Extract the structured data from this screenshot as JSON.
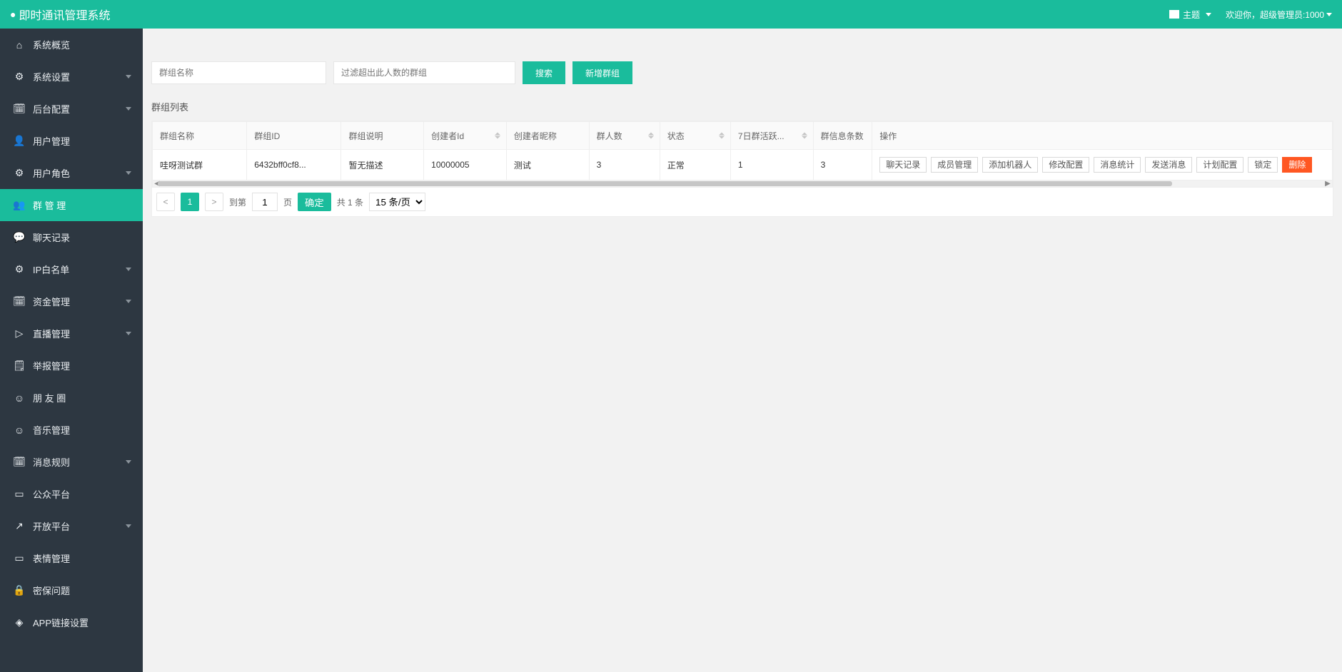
{
  "colors": {
    "accent": "#1abc9c",
    "sidebar": "#2d3741",
    "danger": "#ff5722"
  },
  "header": {
    "title": "即时通讯管理系统",
    "theme_label": "主题",
    "welcome": "欢迎你，超级管理员:1000"
  },
  "sidebar": {
    "items": [
      {
        "icon": "⌂",
        "label": "系统概览",
        "expandable": false
      },
      {
        "icon": "⚙",
        "label": "系统设置",
        "expandable": true
      },
      {
        "icon": "🗓",
        "label": "后台配置",
        "expandable": true
      },
      {
        "icon": "👤",
        "label": "用户管理",
        "expandable": false
      },
      {
        "icon": "⚙",
        "label": "用户角色",
        "expandable": true
      },
      {
        "icon": "👥",
        "label": "群 管 理",
        "expandable": false,
        "active": true
      },
      {
        "icon": "💬",
        "label": "聊天记录",
        "expandable": false
      },
      {
        "icon": "⚙",
        "label": "IP白名单",
        "expandable": true
      },
      {
        "icon": "🗓",
        "label": "资金管理",
        "expandable": true
      },
      {
        "icon": "▷",
        "label": "直播管理",
        "expandable": true
      },
      {
        "icon": "🗒",
        "label": "举报管理",
        "expandable": false
      },
      {
        "icon": "☺",
        "label": "朋 友 圈",
        "expandable": false
      },
      {
        "icon": "☺",
        "label": "音乐管理",
        "expandable": false
      },
      {
        "icon": "🗓",
        "label": "消息规则",
        "expandable": true
      },
      {
        "icon": "▭",
        "label": "公众平台",
        "expandable": false
      },
      {
        "icon": "↗",
        "label": "开放平台",
        "expandable": true
      },
      {
        "icon": "▭",
        "label": "表情管理",
        "expandable": false
      },
      {
        "icon": "🔒",
        "label": "密保问题",
        "expandable": false
      },
      {
        "icon": "◈",
        "label": "APP链接设置",
        "expandable": false
      }
    ]
  },
  "toolbar": {
    "name_placeholder": "群组名称",
    "count_placeholder": "过滤超出此人数的群组",
    "search_label": "搜索",
    "create_label": "新增群组"
  },
  "list": {
    "title": "群组列表",
    "columns": [
      {
        "label": "群组名称",
        "sortable": false
      },
      {
        "label": "群组ID",
        "sortable": false
      },
      {
        "label": "群组说明",
        "sortable": false
      },
      {
        "label": "创建者Id",
        "sortable": true
      },
      {
        "label": "创建者昵称",
        "sortable": false
      },
      {
        "label": "群人数",
        "sortable": true
      },
      {
        "label": "状态",
        "sortable": true
      },
      {
        "label": "7日群活跃...",
        "sortable": true
      },
      {
        "label": "群信息条数",
        "sortable": false
      },
      {
        "label": "操作",
        "sortable": false
      }
    ],
    "rows": [
      {
        "name": "哇呀测试群",
        "gid": "6432bff0cf8...",
        "desc": "暂无描述",
        "creator_id": "10000005",
        "creator_nick": "测试",
        "members": "3",
        "status": "正常",
        "active7": "1",
        "msgcount": "3"
      }
    ],
    "ops": [
      "聊天记录",
      "成员管理",
      "添加机器人",
      "修改配置",
      "消息统计",
      "发送消息",
      "计划配置",
      "锁定",
      "删除"
    ]
  },
  "pager": {
    "current": "1",
    "goto_label": "到第",
    "goto_value": "1",
    "page_label": "页",
    "ok_label": "确定",
    "total_label": "共 1 条",
    "perpage_options": [
      "15 条/页"
    ],
    "perpage_selected": "15 条/页"
  }
}
